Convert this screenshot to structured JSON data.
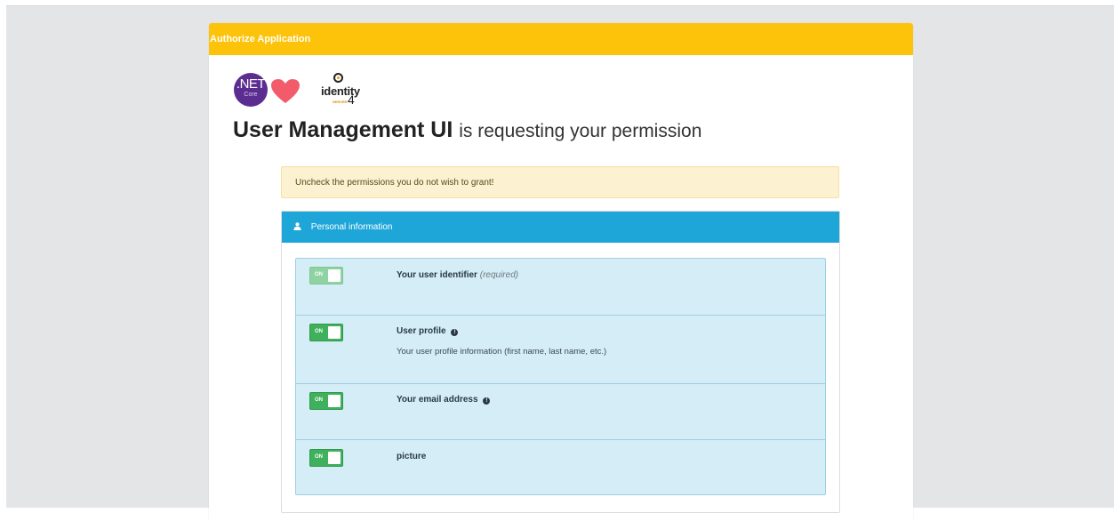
{
  "header": {
    "title": "Authorize Application"
  },
  "logos": {
    "net_text": ".NET",
    "net_sub": "Core",
    "identity_text": "identity",
    "identity_sub": "SERVER",
    "identity_four": "4",
    "brand_purple": "#5c2d91",
    "heart_color": "#f25c6a"
  },
  "consent": {
    "client_name": "User Management UI",
    "requesting_text": "is requesting your permission"
  },
  "warning": {
    "text": "Uncheck the permissions you do not wish to grant!"
  },
  "personal_panel": {
    "title": "Personal information",
    "icon": "user-icon",
    "items": [
      {
        "title": "Your user identifier",
        "required_text": "(required)",
        "description": "",
        "toggle_text": "ON",
        "checked": true,
        "disabled": true
      },
      {
        "title": "User profile",
        "required_text": "",
        "description": "Your user profile information (first name, last name, etc.)",
        "toggle_text": "ON",
        "checked": true,
        "disabled": false
      },
      {
        "title": "Your email address",
        "required_text": "",
        "description": "",
        "toggle_text": "ON",
        "checked": true,
        "disabled": false
      },
      {
        "title": "picture",
        "required_text": "",
        "description": "",
        "toggle_text": "ON",
        "checked": true,
        "disabled": false
      }
    ]
  },
  "colors": {
    "header_bg": "#fcc30a",
    "panel_heading_bg": "#1fa6d8",
    "toggle_on": "#3fb05b",
    "list_bg": "#d4edf6",
    "warning_bg": "#fcf1d0"
  }
}
